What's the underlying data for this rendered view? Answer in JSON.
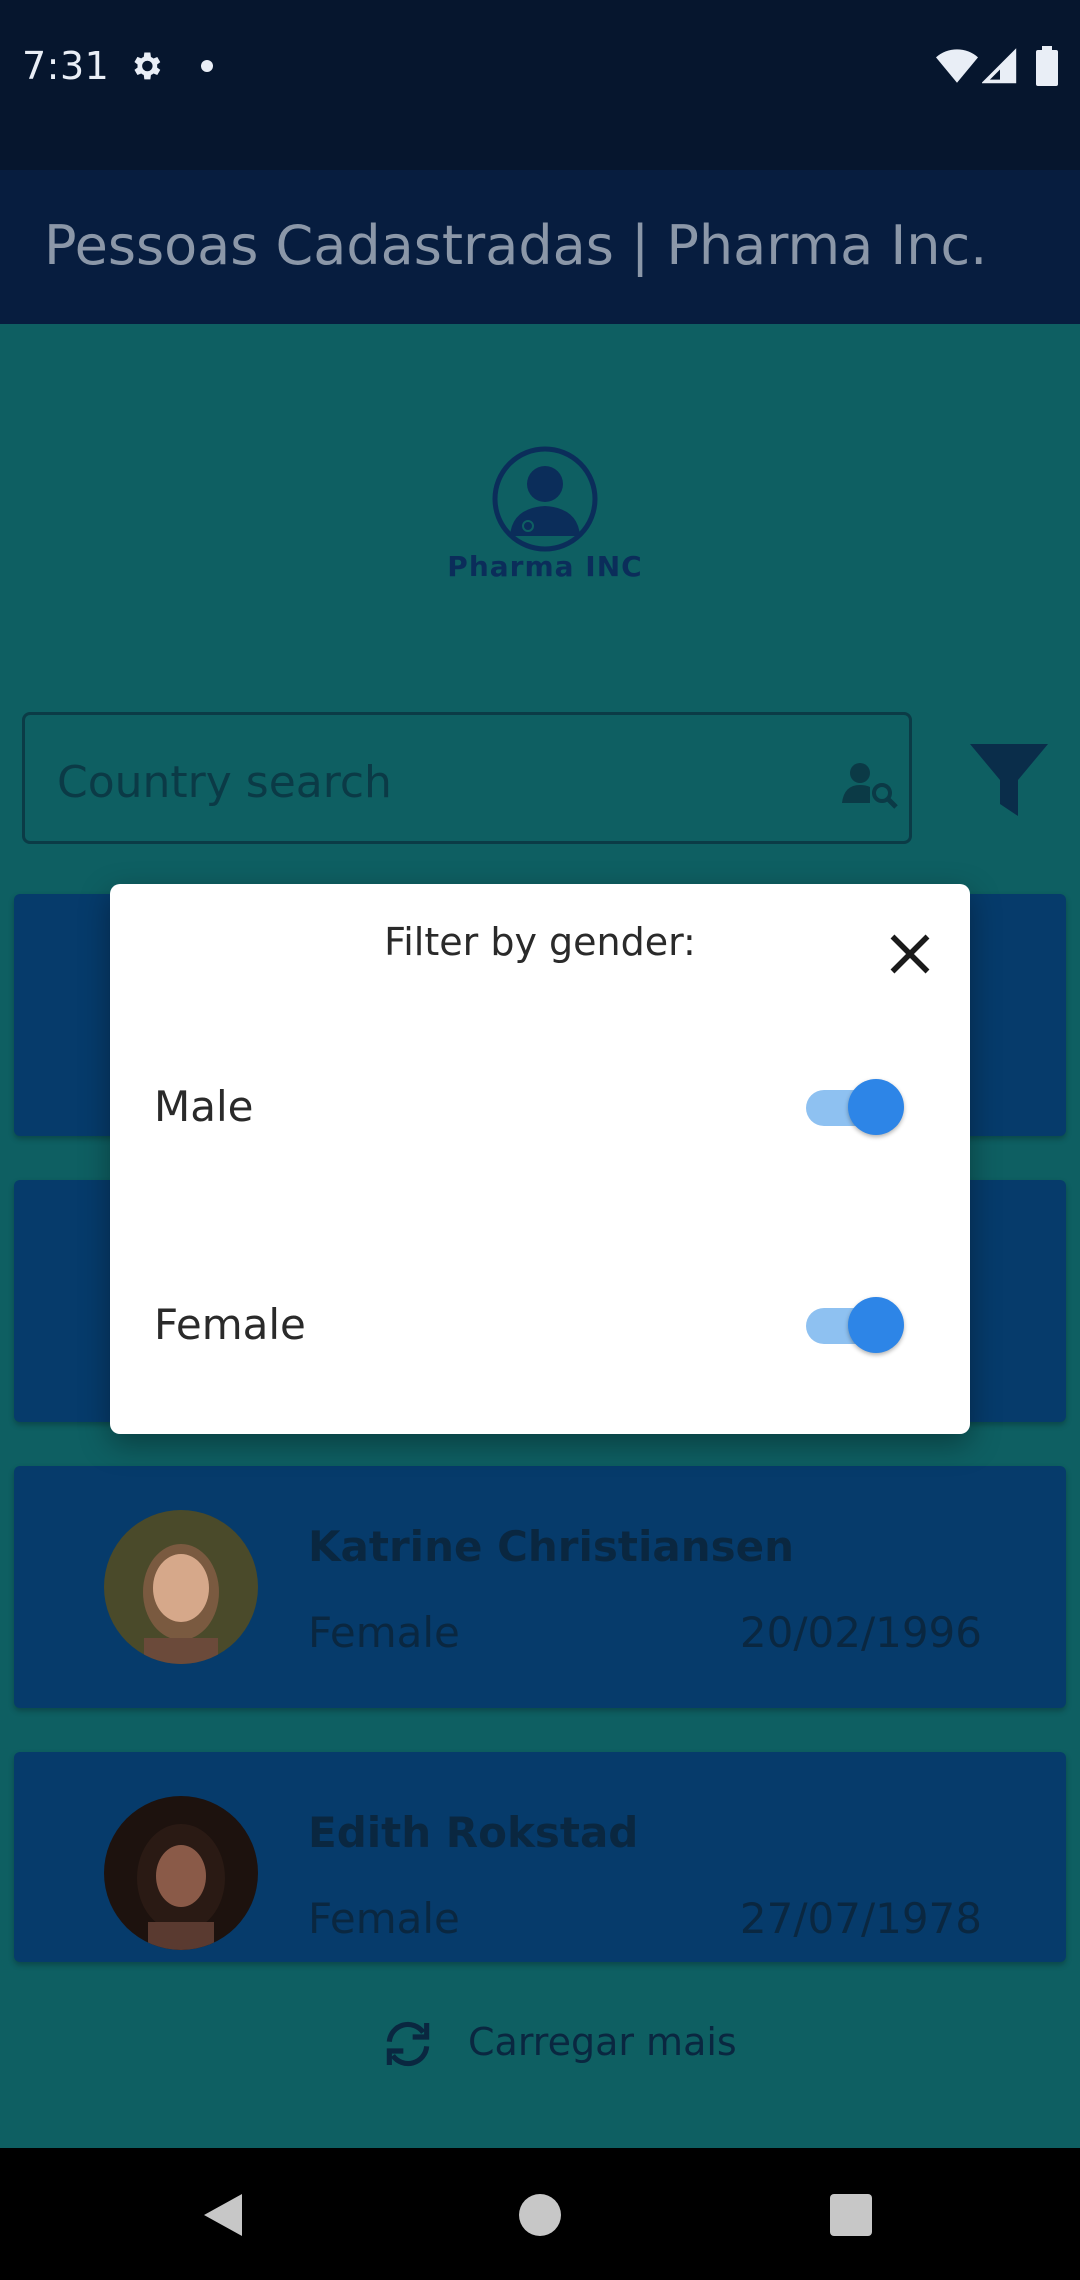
{
  "status_bar": {
    "time": "7:31"
  },
  "app_bar": {
    "title": "Pessoas Cadastradas | Pharma Inc."
  },
  "logo": {
    "text": "Pharma INC"
  },
  "search": {
    "placeholder": "Country search"
  },
  "cards": [
    {
      "name": "Katrine Christiansen",
      "gender": "Female",
      "date": "20/02/1996"
    },
    {
      "name": "Edith Rokstad",
      "gender": "Female",
      "date": "27/07/1978"
    }
  ],
  "load_more": {
    "label": "Carregar mais"
  },
  "dialog": {
    "title": "Filter by gender:",
    "options": [
      {
        "label": "Male",
        "enabled": true
      },
      {
        "label": "Female",
        "enabled": true
      }
    ]
  },
  "colors": {
    "accent": "#2d85e7",
    "app_bar": "#071d3f",
    "card": "#063b6b",
    "background": "#0e5f62"
  },
  "icons": [
    "gear-icon",
    "wifi-icon",
    "signal-icon",
    "battery-icon",
    "search-person-icon",
    "filter-icon",
    "close-icon",
    "refresh-icon",
    "back-icon",
    "home-icon",
    "recents-icon"
  ]
}
